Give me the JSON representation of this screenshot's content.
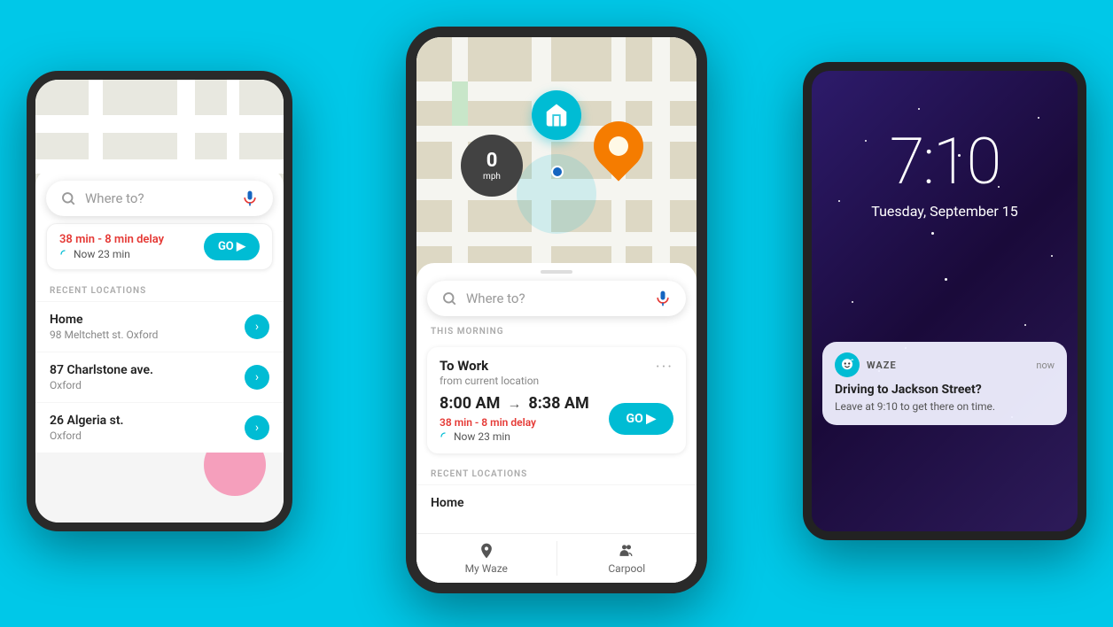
{
  "background_color": "#00c8e8",
  "left_phone": {
    "search_placeholder": "Where to?",
    "top_card": {
      "delay": "38 min - 8 min delay",
      "now_time": "Now 23 min",
      "go_label": "GO ▶"
    },
    "section_label": "RECENT LOCATIONS",
    "locations": [
      {
        "name": "Home",
        "address": "98 Meltchett st. Oxford"
      },
      {
        "name": "87 Charlstone ave.",
        "address": "Oxford"
      },
      {
        "name": "26 Algeria st.",
        "address": "Oxford"
      }
    ]
  },
  "center_phone": {
    "search_placeholder": "Where to?",
    "speed": "0",
    "speed_unit": "mph",
    "this_morning_label": "THIS MORNING",
    "work_card": {
      "title": "To Work",
      "subtitle": "from current location",
      "time_start": "8:00 AM",
      "time_arrow": "→",
      "time_end": "8:38 AM",
      "delay": "38 min - 8 min delay",
      "now_time": "Now 23 min",
      "go_label": "GO ▶"
    },
    "section_label": "RECENT LOCATIONS",
    "recent_first": "Home",
    "nav": {
      "my_waze": "My Waze",
      "carpool": "Carpool"
    }
  },
  "right_phone": {
    "time": "7:10",
    "date": "Tuesday, September 15",
    "notification": {
      "app_name": "WAZE",
      "time": "now",
      "title": "Driving to Jackson Street?",
      "body": "Leave at 9:10 to get there on time."
    }
  },
  "icons": {
    "search": "🔍",
    "mic": "🎤",
    "arrow_right": "›",
    "go_arrow": "▶",
    "signal": "↺",
    "pin": "📍",
    "people": "👥"
  }
}
